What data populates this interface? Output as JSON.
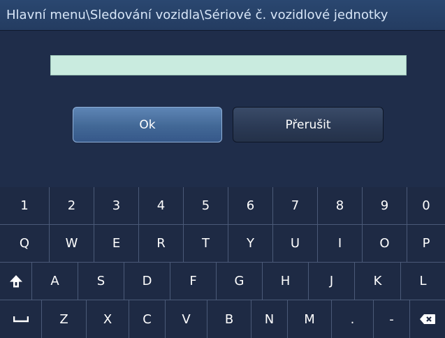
{
  "window": {
    "breadcrumb": "Hlavní menu\\Sledování vozidla\\Sériové č. vozidlové jednotky"
  },
  "input": {
    "value": ""
  },
  "buttons": {
    "ok_label": "Ok",
    "cancel_label": "Přerušit"
  },
  "keyboard": {
    "row1": [
      "1",
      "2",
      "3",
      "4",
      "5",
      "6",
      "7",
      "8",
      "9",
      "0"
    ],
    "row2": [
      "Q",
      "W",
      "E",
      "R",
      "T",
      "Y",
      "U",
      "I",
      "O",
      "P"
    ],
    "row3": [
      "A",
      "S",
      "D",
      "F",
      "G",
      "H",
      "J",
      "K",
      "L"
    ],
    "row4": [
      "Z",
      "X",
      "C",
      "V",
      "B",
      "N",
      "M",
      ".",
      "-"
    ],
    "shift_icon": "shift-arrow-icon",
    "space_icon": "space-bar-icon",
    "backspace_icon": "backspace-icon"
  },
  "colors": {
    "background": "#1f2d4a",
    "titlebar": "#2a4770",
    "input": "#c9ebdf",
    "ok_button": "#426896",
    "cancel_button": "#2b3a55",
    "key_border": "#4b5a78"
  }
}
